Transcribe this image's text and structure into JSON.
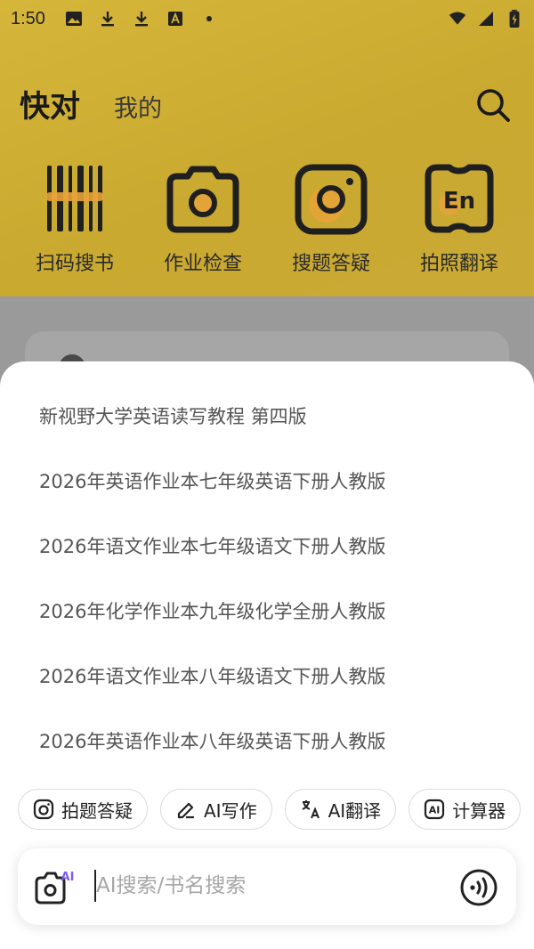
{
  "status_bar": {
    "time": "1:50",
    "icons": [
      "image-icon",
      "download-icon",
      "download-icon",
      "keyboard-a-icon",
      "dot-icon",
      "wifi-icon",
      "signal-icon",
      "battery-charging-icon"
    ]
  },
  "header": {
    "tabs": [
      {
        "label": "快对",
        "active": true
      },
      {
        "label": "我的",
        "active": false
      }
    ],
    "search_icon": "search-icon"
  },
  "tools": [
    {
      "label": "扫码搜书",
      "icon": "barcode-icon"
    },
    {
      "label": "作业检查",
      "icon": "camera-check-icon"
    },
    {
      "label": "搜题答疑",
      "icon": "camera-search-icon"
    },
    {
      "label": "拍照翻译",
      "icon": "translate-en-icon"
    }
  ],
  "suggestions": [
    "新视野大学英语读写教程 第四版",
    "2026年英语作业本七年级英语下册人教版",
    "2026年语文作业本七年级语文下册人教版",
    "2026年化学作业本九年级化学全册人教版",
    "2026年语文作业本八年级语文下册人教版",
    "2026年英语作业本八年级英语下册人教版"
  ],
  "chips": [
    {
      "label": "拍题答疑",
      "icon": "camera-icon"
    },
    {
      "label": "AI写作",
      "icon": "pen-icon"
    },
    {
      "label": "AI翻译",
      "icon": "translate-icon"
    },
    {
      "label": "计算器",
      "icon": "ai-box-icon"
    }
  ],
  "search": {
    "placeholder": "AI搜索/书名搜索",
    "value": "",
    "camera_badge": "AI"
  },
  "colors": {
    "hero": "#d2b23a",
    "accent": "#e8a23a",
    "badge": "#7b5cf5"
  }
}
